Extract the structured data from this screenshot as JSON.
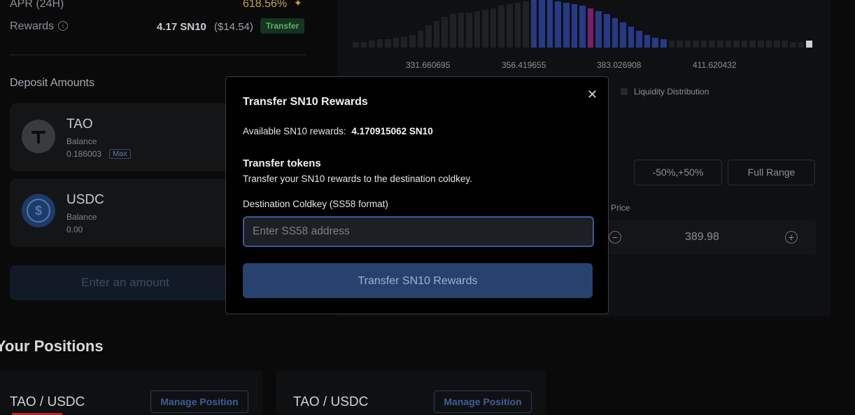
{
  "stats": {
    "apr_label": "APR (24H)",
    "apr_value": "618.56%",
    "rewards_label": "Rewards",
    "rewards_value": "4.17 SN10",
    "rewards_usd": "($14.54)",
    "transfer_label": "Transfer"
  },
  "deposit": {
    "title": "Deposit Amounts",
    "tokens": [
      {
        "symbol": "TAO",
        "balance_label": "Balance",
        "balance": "0.186003",
        "max_label": "Max"
      },
      {
        "symbol": "USDC",
        "balance_label": "Balance",
        "balance": "0.00"
      }
    ],
    "enter_amount": "Enter an amount"
  },
  "positions": {
    "title": "Your Positions",
    "items": [
      {
        "pair": "TAO / USDC",
        "manage_label": "Manage Position"
      },
      {
        "pair": "TAO / USDC",
        "manage_label": "Manage Position"
      }
    ]
  },
  "chart": {
    "ticks": [
      "331.660695",
      "356.419655",
      "383.026908",
      "411.620432"
    ],
    "legend": "Liquidity Distribution",
    "colors": {
      "neutral": "#202124",
      "in_range": "#273a86",
      "current": "#7a1f6a"
    }
  },
  "range": {
    "buttons": [
      "-50%,+50%",
      "Full Range"
    ],
    "price_label": "Price",
    "price_value": "389.98"
  },
  "modal": {
    "title": "Transfer SN10 Rewards",
    "available_label": "Available SN10 rewards:",
    "available_value": "4.170915062 SN10",
    "section_title": "Transfer tokens",
    "section_desc": "Transfer your SN10 rewards to the destination coldkey.",
    "field_label": "Destination Coldkey (SS58 format)",
    "field_placeholder": "Enter SS58 address",
    "field_value": "",
    "submit_label": "Transfer SN10 Rewards",
    "close_icon": "close-icon"
  }
}
